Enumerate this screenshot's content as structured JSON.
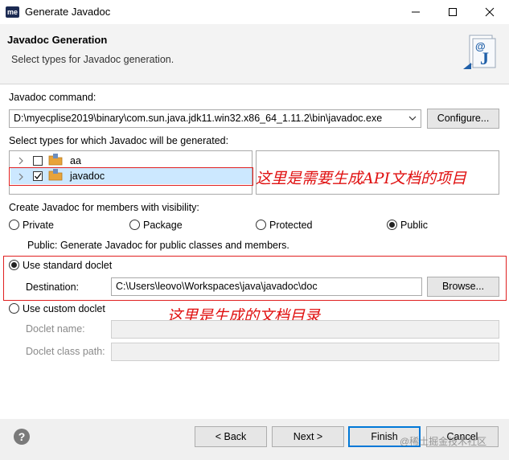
{
  "window": {
    "app_icon_text": "me",
    "title": "Generate Javadoc"
  },
  "header": {
    "title": "Javadoc Generation",
    "description": "Select types for Javadoc generation."
  },
  "command": {
    "label": "Javadoc command:",
    "value": "D:\\myecplise2019\\binary\\com.sun.java.jdk11.win32.x86_64_1.11.2\\bin\\javadoc.exe",
    "configure_label": "Configure..."
  },
  "types": {
    "label": "Select types for which Javadoc will be generated:",
    "items": [
      {
        "name": "aa",
        "checked": false
      },
      {
        "name": "javadoc",
        "checked": true
      }
    ]
  },
  "visibility": {
    "label": "Create Javadoc for members with visibility:",
    "options": [
      "Private",
      "Package",
      "Protected",
      "Public"
    ],
    "selected": "Public",
    "description": "Public: Generate Javadoc for public classes and members."
  },
  "doclet": {
    "standard_label": "Use standard doclet",
    "destination_label": "Destination:",
    "destination_value": "C:\\Users\\leovo\\Workspaces\\java\\javadoc\\doc",
    "browse_label": "Browse...",
    "custom_label": "Use custom doclet",
    "doclet_name_label": "Doclet name:",
    "doclet_class_path_label": "Doclet class path:"
  },
  "annotations": {
    "project": "这里是需要生成API文档的项目",
    "directory": "这里是生成的文档目录"
  },
  "footer": {
    "back_label": "< Back",
    "next_label": "Next >",
    "finish_label": "Finish",
    "cancel_label": "Cancel",
    "watermark": "@稀土掘金技术社区"
  },
  "colors": {
    "annotation": "#e01010",
    "primary_border": "#0078d7",
    "folder": "#e8a33a"
  }
}
